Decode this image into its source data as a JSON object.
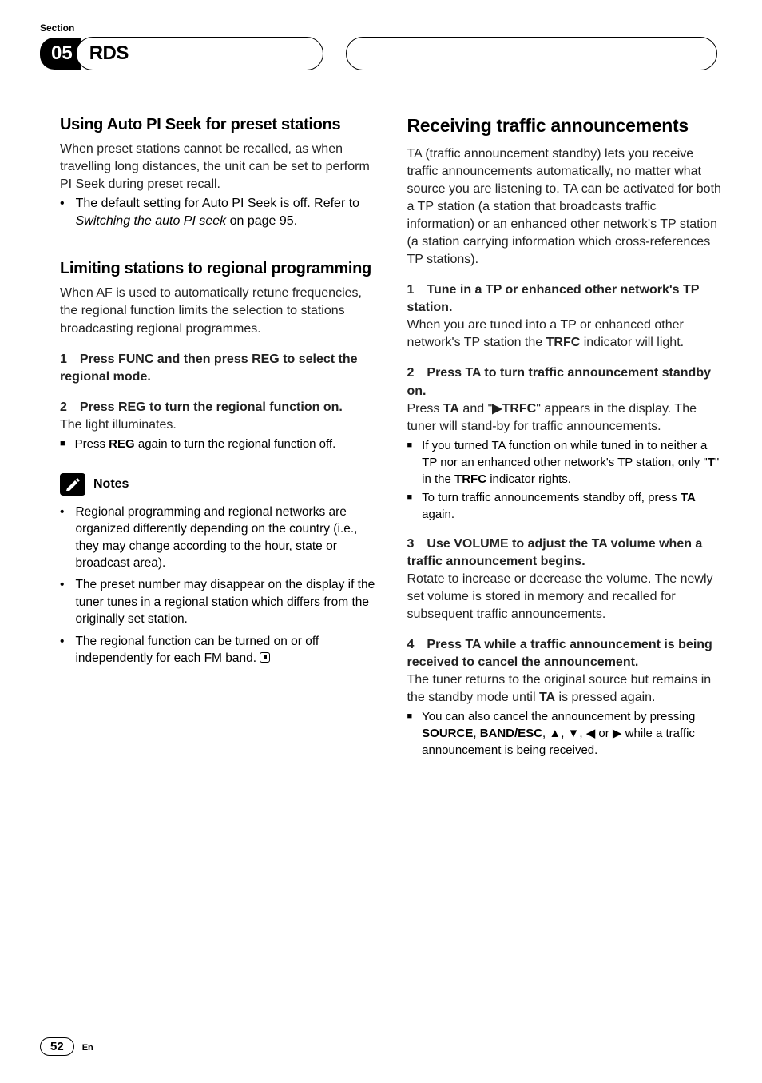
{
  "header": {
    "section_label": "Section",
    "section_number": "05",
    "section_title": "RDS"
  },
  "left": {
    "h1": "Using Auto PI Seek for preset stations",
    "p1": "When preset stations cannot be recalled, as when travelling long distances, the unit can be set to perform PI Seek during preset recall.",
    "b1_pre": "The default setting for Auto PI Seek is off. Refer to ",
    "b1_italic": "Switching the auto PI seek",
    "b1_post": " on page 95.",
    "h2": "Limiting stations to regional programming",
    "p2": "When AF is used to automatically retune frequencies, the regional function limits the selection to stations broadcasting regional programmes.",
    "s1_head": "1 Press FUNC and then press REG to select the regional mode.",
    "s2_head": "2 Press REG to turn the regional function on.",
    "s2_body": "The light illuminates.",
    "sq1_pre": "Press ",
    "sq1_bold": "REG",
    "sq1_post": " again to turn the regional function off.",
    "notes_label": "Notes",
    "n1": "Regional programming and regional networks are organized differently depending on the country (i.e., they may change according to the hour, state or broadcast area).",
    "n2": "The preset number may disappear on the display if the tuner tunes in a regional station which differs from the originally set station.",
    "n3": "The regional function can be turned on or off independently for each FM band."
  },
  "right": {
    "h1": "Receiving traffic announcements",
    "p1": "TA (traffic announcement standby) lets you receive traffic announcements automatically, no matter what source you are listening to. TA can be activated for both a TP station (a station that broadcasts traffic information) or an enhanced other network's TP station (a station carrying information which cross-references TP stations).",
    "s1_head": "1 Tune in a TP or enhanced other network's TP station.",
    "s1_body_pre": "When you are tuned into a TP or enhanced other network's TP station the ",
    "s1_body_bold": "TRFC",
    "s1_body_post": " indicator will light.",
    "s2_head": "2 Press TA to turn traffic announcement standby on.",
    "s2_body_pre": "Press ",
    "s2_body_b1": "TA",
    "s2_body_mid1": " and \"",
    "s2_body_b2": "▶TRFC",
    "s2_body_mid2": "\" appears in the display. The tuner will stand-by for traffic announcements.",
    "sq1_pre": "If you turned TA function on while tuned in to neither a TP nor an enhanced other network's TP station, only \"",
    "sq1_b1": "T",
    "sq1_mid": "\" in the ",
    "sq1_b2": "TRFC",
    "sq1_post": " indicator rights.",
    "sq2_pre": "To turn traffic announcements standby off, press ",
    "sq2_b": "TA",
    "sq2_post": " again.",
    "s3_head": "3 Use VOLUME to adjust the TA volume when a traffic announcement begins.",
    "s3_body": "Rotate to increase or decrease the volume. The newly set volume is stored in memory and recalled for subsequent traffic announcements.",
    "s4_head": "4 Press TA while a traffic announcement is being received to cancel the announcement.",
    "s4_body_pre": "The tuner returns to the original source but remains in the standby mode until ",
    "s4_body_b": "TA",
    "s4_body_post": " is pressed again.",
    "sq3_pre": "You can also cancel the announcement by pressing ",
    "sq3_b1": "SOURCE",
    "sq3_m1": ", ",
    "sq3_b2": "BAND/ESC",
    "sq3_m2": ", ▲, ▼, ◀ or ▶ while a traffic announcement is being received."
  },
  "footer": {
    "page": "52",
    "lang": "En"
  }
}
